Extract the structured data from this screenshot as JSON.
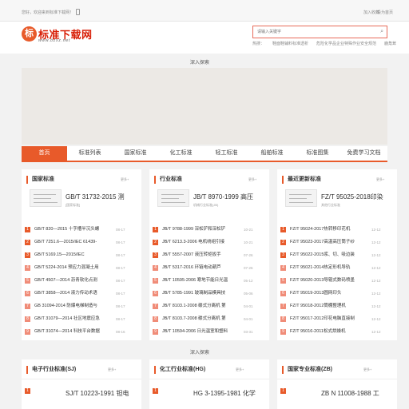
{
  "topbar": {
    "welcome": "您好，欢迎来到标准下载网！",
    "favorite": "加入收藏",
    "home": "设为首页"
  },
  "header": {
    "logo_char": "标",
    "logo_text": "标准下载网",
    "logo_url": "www.bzxz.net"
  },
  "search": {
    "placeholder": "请输入关键字",
    "hot_label": "热搜：",
    "hot": [
      "鞋面鞋辅料标准透析",
      "危险化学品企业特殊作业安全规范",
      "鹿角茸"
    ]
  },
  "ad_label": "深入探索",
  "nav": {
    "items": [
      "首页",
      "标准列表",
      "国家标准",
      "化工标准",
      "轻工标准",
      "船舶标准",
      "标准图集",
      "免费学习文档"
    ],
    "active": 0
  },
  "sections": [
    {
      "title": "国家标准",
      "more": "更多+",
      "featured": {
        "title": "GB/T 31732-2015 测",
        "sub": "[国家标准]"
      },
      "items": [
        {
          "t": "GB/T 820—2015 十字槽半沉头螺",
          "d": "08-17"
        },
        {
          "t": "GB/T 7251.6—2015/IEC 61439-",
          "d": "08-17"
        },
        {
          "t": "GB/T 5169.15—2015/IEC",
          "d": "08-17"
        },
        {
          "t": "GB/T 5224-2014 预应力混凝土用",
          "d": "08-17"
        },
        {
          "t": "GB/T 4507—2014 沥青软化点测",
          "d": "08-17"
        },
        {
          "t": "GB/T 3858—2014 液力传动术语",
          "d": "08-17"
        },
        {
          "t": "GB 31094-2014 防爆电梯制造与",
          "d": "08-17"
        },
        {
          "t": "GB/T 31079—2014 社区地震应急",
          "d": "08-17"
        },
        {
          "t": "GB/T 31074—2014 科技平台数据",
          "d": "08-16"
        }
      ]
    },
    {
      "title": "行业标准",
      "more": "更多+",
      "featured": {
        "title": "JB/T 8970-1999 高压",
        "sub": "机械行业标准(JB)"
      },
      "items": [
        {
          "t": "JB/T 9788-1999 深松铲和深松铲",
          "d": "10-21"
        },
        {
          "t": "JB/T 6213.3-2006 电机绕组引接",
          "d": "10-21"
        },
        {
          "t": "JB/T 5557-2007 液压转矩扳手",
          "d": "07-26"
        },
        {
          "t": "JB/T 5317-2016 环链电动葫芦",
          "d": "07-26"
        },
        {
          "t": "JB/T 10595-2006 寒地节能日光温",
          "d": "05-12"
        },
        {
          "t": "JB/T 5785-1991 玻璃制品模具技",
          "d": "05-06"
        },
        {
          "t": "JB/T 8103.1-2008 碟式分离机 第",
          "d": "04-01"
        },
        {
          "t": "JB/T 8103.7-2008 碟式分离机 第",
          "d": "04-01"
        },
        {
          "t": "JB/T 10594-2006 日光温室和塑料",
          "d": "03-31"
        }
      ]
    },
    {
      "title": "最近更新标准",
      "more": "更多+",
      "featured": {
        "title": "FZ/T 95025-2018印染",
        "sub": "其他行业标准"
      },
      "items": [
        {
          "t": "FZ/T 95024-2017热转移印花机",
          "d": "12-12"
        },
        {
          "t": "FZ/T 95023-2017高温高压筒子纱",
          "d": "12-12"
        },
        {
          "t": "FZ/T 95022-2015浆、切、吸边装",
          "d": "12-12"
        },
        {
          "t": "FZ/T 95021-2014热定形机导轨",
          "d": "12-12"
        },
        {
          "t": "FZ/T 95020-2013导辊式数码喷墨",
          "d": "12-12"
        },
        {
          "t": "FZ/T 95019-2013圆网印头",
          "d": "12-12"
        },
        {
          "t": "FZ/T 95018-2012筒棚整理机",
          "d": "12-12"
        },
        {
          "t": "FZ/T 95017-2012印花电脑直接制",
          "d": "12-12"
        },
        {
          "t": "FZ/T 95016-2011松式烘燥机",
          "d": "12-12"
        }
      ]
    }
  ],
  "ad_label_2": "深入探索",
  "sections2": [
    {
      "title": "电子行业标准(SJ)",
      "more": "更多+",
      "featured": {
        "title": "SJ/T 10223-1991 钽电"
      }
    },
    {
      "title": "化工行业标准(HG)",
      "more": "更多+",
      "featured": {
        "title": "HG 3-1395-1981 化学"
      }
    },
    {
      "title": "国家专业标准(ZB)",
      "more": "更多+",
      "featured": {
        "title": "ZB N 11008-1988 工"
      }
    }
  ],
  "colors": {
    "accent": "#e85a2a",
    "brand": "#d81e06"
  }
}
